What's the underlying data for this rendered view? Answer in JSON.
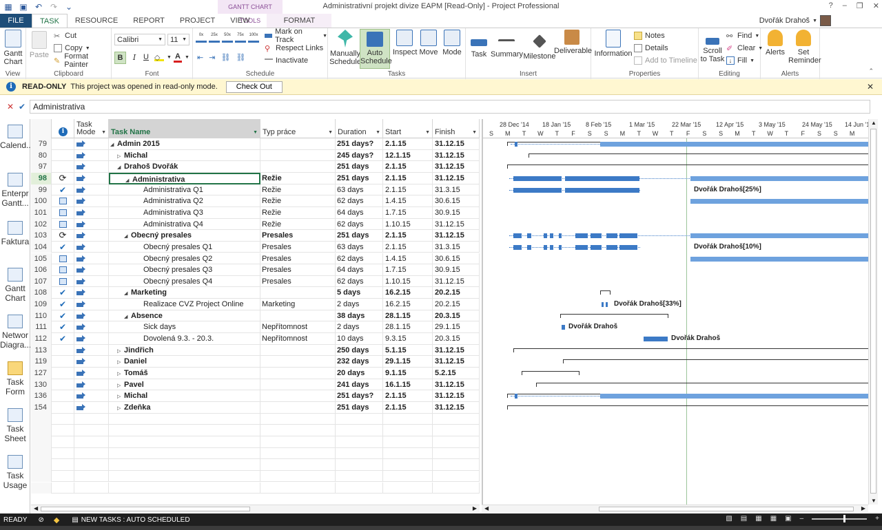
{
  "window": {
    "title": "Administrativní projekt divize EAPM [Read-Only] - Project Professional",
    "contextual_header": "GANTT CHART TOOLS",
    "user_name": "Dvořák Drahoš",
    "buttons": [
      "?",
      "–",
      "❐",
      "✕"
    ]
  },
  "qat": {
    "icons": [
      "project-icon",
      "save-icon",
      "undo-icon",
      "redo-icon",
      "customize-icon"
    ]
  },
  "tabs": [
    "FILE",
    "TASK",
    "RESOURCE",
    "REPORT",
    "PROJECT",
    "VIEW",
    "FORMAT"
  ],
  "ribbon": {
    "view": {
      "label": "View",
      "gantt": "Gantt\nChart"
    },
    "clipboard": {
      "label": "Clipboard",
      "paste": "Paste",
      "cut": "Cut",
      "copy": "Copy",
      "format_painter": "Format Painter"
    },
    "font": {
      "label": "Font",
      "family": "Calibri",
      "size": "11",
      "bold": "B",
      "italic": "I",
      "underline": "U"
    },
    "schedule": {
      "label": "Schedule",
      "mark_on_track": "Mark on Track",
      "respect_links": "Respect Links",
      "inactivate": "Inactivate",
      "pct": [
        "0x",
        "25x",
        "50x",
        "75x",
        "100x"
      ]
    },
    "tasks": {
      "label": "Tasks",
      "manually": "Manually\nSchedule",
      "auto": "Auto\nSchedule",
      "inspect": "Inspect",
      "move": "Move",
      "mode": "Mode"
    },
    "insert": {
      "label": "Insert",
      "task": "Task",
      "summary": "Summary",
      "milestone": "Milestone",
      "deliverable": "Deliverable"
    },
    "properties": {
      "label": "Properties",
      "information": "Information",
      "notes": "Notes",
      "details": "Details",
      "add_to_timeline": "Add to Timeline"
    },
    "editing": {
      "label": "Editing",
      "scroll_to_task": "Scroll\nto Task",
      "find": "Find",
      "clear": "Clear",
      "fill": "Fill"
    },
    "alerts": {
      "label": "Alerts",
      "alerts": "Alerts",
      "set_reminder": "Set\nReminder"
    }
  },
  "readonly_bar": {
    "title": "READ-ONLY",
    "message": "This project was opened in read-only mode.",
    "button": "Check Out"
  },
  "entry_bar": {
    "value": "Administrativa"
  },
  "view_bar": [
    "Calend...",
    "Enterpr\nGantt...",
    "Faktura",
    "Gantt\nChart",
    "Networ\nDiagra...",
    "Task\nForm",
    "Task\nSheet",
    "Task\nUsage"
  ],
  "columns": {
    "task_mode": "Task\nMode",
    "task_name": "Task Name",
    "typ_prace": "Typ práce",
    "duration": "Duration",
    "start": "Start",
    "finish": "Finish"
  },
  "rows": [
    {
      "id": "79",
      "ind": "",
      "name": "Admin 2015",
      "level": 0,
      "toggle": "▲",
      "typ": "",
      "dur": "251 days?",
      "start": "2.1.15",
      "fin": "31.12.15",
      "bold": true
    },
    {
      "id": "80",
      "ind": "",
      "name": "Michal",
      "level": 1,
      "toggle": "▷",
      "typ": "",
      "dur": "245 days?",
      "start": "12.1.15",
      "fin": "31.12.15",
      "bold": true
    },
    {
      "id": "97",
      "ind": "",
      "name": "Drahoš Dvořák",
      "level": 1,
      "toggle": "▲",
      "typ": "",
      "dur": "251 days",
      "start": "2.1.15",
      "fin": "31.12.15",
      "bold": true
    },
    {
      "id": "98",
      "ind": "recurring",
      "name": "Administrativa",
      "level": 2,
      "toggle": "▲",
      "typ": "Režie",
      "dur": "251 days",
      "start": "2.1.15",
      "fin": "31.12.15",
      "bold": true,
      "selected": true
    },
    {
      "id": "99",
      "ind": "check",
      "name": "Administrativa Q1",
      "level": 3,
      "toggle": "",
      "typ": "Režie",
      "dur": "63 days",
      "start": "2.1.15",
      "fin": "31.3.15",
      "bold": false
    },
    {
      "id": "100",
      "ind": "cal",
      "name": "Administrativa Q2",
      "level": 3,
      "toggle": "",
      "typ": "Režie",
      "dur": "62 days",
      "start": "1.4.15",
      "fin": "30.6.15",
      "bold": false
    },
    {
      "id": "101",
      "ind": "cal",
      "name": "Administrativa Q3",
      "level": 3,
      "toggle": "",
      "typ": "Režie",
      "dur": "64 days",
      "start": "1.7.15",
      "fin": "30.9.15",
      "bold": false
    },
    {
      "id": "102",
      "ind": "cal",
      "name": "Administrativa Q4",
      "level": 3,
      "toggle": "",
      "typ": "Režie",
      "dur": "62 days",
      "start": "1.10.15",
      "fin": "31.12.15",
      "bold": false
    },
    {
      "id": "103",
      "ind": "recurring",
      "name": "Obecný presales",
      "level": 2,
      "toggle": "▲",
      "typ": "Presales",
      "dur": "251 days",
      "start": "2.1.15",
      "fin": "31.12.15",
      "bold": true
    },
    {
      "id": "104",
      "ind": "check",
      "name": "Obecný presales Q1",
      "level": 3,
      "toggle": "",
      "typ": "Presales",
      "dur": "63 days",
      "start": "2.1.15",
      "fin": "31.3.15",
      "bold": false
    },
    {
      "id": "105",
      "ind": "cal",
      "name": "Obecný presales Q2",
      "level": 3,
      "toggle": "",
      "typ": "Presales",
      "dur": "62 days",
      "start": "1.4.15",
      "fin": "30.6.15",
      "bold": false
    },
    {
      "id": "106",
      "ind": "cal",
      "name": "Obecný presales Q3",
      "level": 3,
      "toggle": "",
      "typ": "Presales",
      "dur": "64 days",
      "start": "1.7.15",
      "fin": "30.9.15",
      "bold": false
    },
    {
      "id": "107",
      "ind": "cal",
      "name": "Obecný presales Q4",
      "level": 3,
      "toggle": "",
      "typ": "Presales",
      "dur": "62 days",
      "start": "1.10.15",
      "fin": "31.12.15",
      "bold": false
    },
    {
      "id": "108",
      "ind": "check",
      "name": "Marketing",
      "level": 2,
      "toggle": "▲",
      "typ": "",
      "dur": "5 days",
      "start": "16.2.15",
      "fin": "20.2.15",
      "bold": true
    },
    {
      "id": "109",
      "ind": "check",
      "name": "Realizace CVZ Project Online",
      "level": 3,
      "toggle": "",
      "typ": "Marketing",
      "dur": "2 days",
      "start": "16.2.15",
      "fin": "20.2.15",
      "bold": false
    },
    {
      "id": "110",
      "ind": "check",
      "name": "Absence",
      "level": 2,
      "toggle": "▲",
      "typ": "",
      "dur": "38 days",
      "start": "28.1.15",
      "fin": "20.3.15",
      "bold": true
    },
    {
      "id": "111",
      "ind": "check",
      "name": "Sick days",
      "level": 3,
      "toggle": "",
      "typ": "Nepřítomnost",
      "dur": "2 days",
      "start": "28.1.15",
      "fin": "29.1.15",
      "bold": false
    },
    {
      "id": "112",
      "ind": "check",
      "name": "Dovolená 9.3. - 20.3.",
      "level": 3,
      "toggle": "",
      "typ": "Nepřítomnost",
      "dur": "10 days",
      "start": "9.3.15",
      "fin": "20.3.15",
      "bold": false
    },
    {
      "id": "113",
      "ind": "",
      "name": "Jindřich",
      "level": 1,
      "toggle": "▷",
      "typ": "",
      "dur": "250 days",
      "start": "5.1.15",
      "fin": "31.12.15",
      "bold": true
    },
    {
      "id": "119",
      "ind": "",
      "name": "Daniel",
      "level": 1,
      "toggle": "▷",
      "typ": "",
      "dur": "232 days",
      "start": "29.1.15",
      "fin": "31.12.15",
      "bold": true
    },
    {
      "id": "127",
      "ind": "",
      "name": "Tomáš",
      "level": 1,
      "toggle": "▷",
      "typ": "",
      "dur": "20 days",
      "start": "9.1.15",
      "fin": "5.2.15",
      "bold": true
    },
    {
      "id": "130",
      "ind": "",
      "name": "Pavel",
      "level": 1,
      "toggle": "▷",
      "typ": "",
      "dur": "241 days",
      "start": "16.1.15",
      "fin": "31.12.15",
      "bold": true
    },
    {
      "id": "136",
      "ind": "",
      "name": "Michal",
      "level": 1,
      "toggle": "▷",
      "typ": "",
      "dur": "251 days?",
      "start": "2.1.15",
      "fin": "31.12.15",
      "bold": true
    },
    {
      "id": "154",
      "ind": "",
      "name": "Zdeňka",
      "level": 1,
      "toggle": "▷",
      "typ": "",
      "dur": "251 days",
      "start": "2.1.15",
      "fin": "31.12.15",
      "bold": true
    }
  ],
  "gantt": {
    "dates": [
      "28 Dec '14",
      "18 Jan '15",
      "8 Feb '15",
      "1 Mar '15",
      "22 Mar '15",
      "12 Apr '15",
      "3 May '15",
      "24 May '15",
      "14 Jun '1"
    ],
    "days": [
      "S",
      "M",
      "T",
      "W",
      "T",
      "F",
      "S",
      "S",
      "M",
      "T",
      "W",
      "T",
      "F",
      "S",
      "S",
      "M",
      "T",
      "W",
      "T",
      "F",
      "S",
      "S",
      "M"
    ],
    "labels": {
      "r99": "Dvořák Drahoš[25%]",
      "r104": "Dvořák Drahoš[10%]",
      "r109": "Dvořák Drahoš[33%]",
      "r111": "Dvořák Drahoš",
      "r112": "Dvořák Drahoš"
    }
  },
  "status": {
    "ready": "READY",
    "new_tasks": "NEW TASKS : AUTO SCHEDULED",
    "zoom_minus": "–",
    "zoom_plus": "+"
  }
}
